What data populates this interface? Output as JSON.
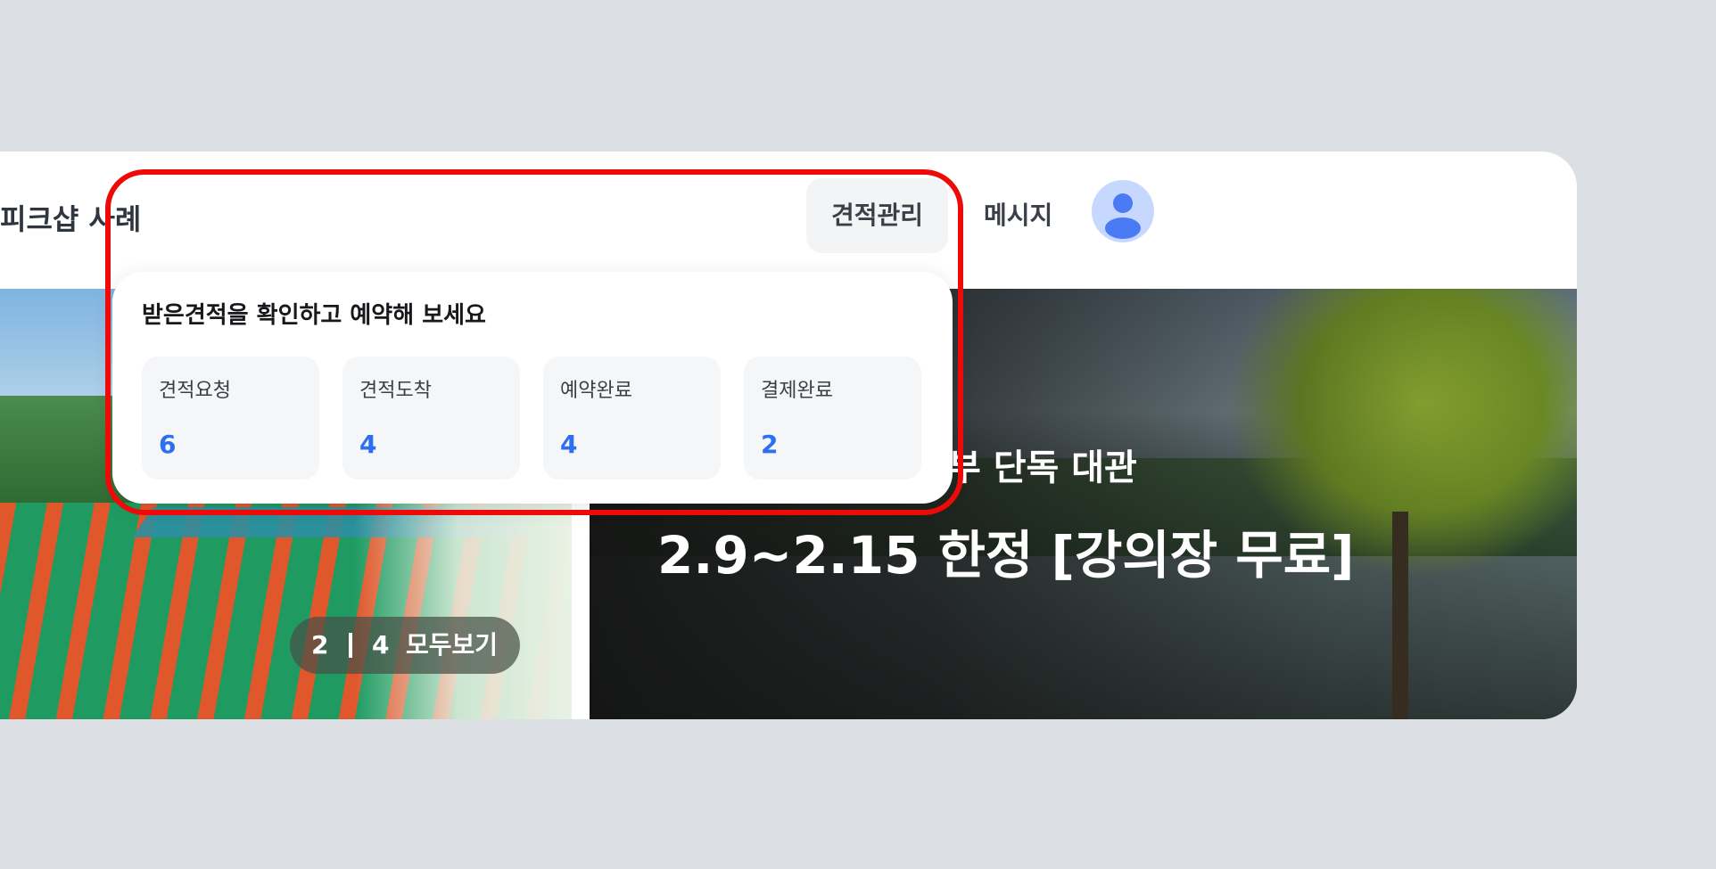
{
  "header": {
    "brand": "피크샵 사례",
    "nav": {
      "quote_manage": "견적관리",
      "messages": "메시지"
    }
  },
  "quote_dropdown": {
    "title": "받은견적을 확인하고 예약해 보세요",
    "stats": [
      {
        "label": "견적요청",
        "value": "6"
      },
      {
        "label": "견적도착",
        "value": "4"
      },
      {
        "label": "예약완료",
        "value": "4"
      },
      {
        "label": "결제완료",
        "value": "2"
      }
    ]
  },
  "banner": {
    "pager": {
      "current": "2",
      "total": "4",
      "view_all": "모두보기"
    },
    "subtitle": "부 단독 대관",
    "title": "2.9~2.15 한정 [강의장 무료]"
  },
  "colors": {
    "accent": "#2d6ff0",
    "highlight": "#ef0a0a",
    "background": "#dcdfe3"
  },
  "icons": {
    "avatar": "user-avatar-icon"
  }
}
